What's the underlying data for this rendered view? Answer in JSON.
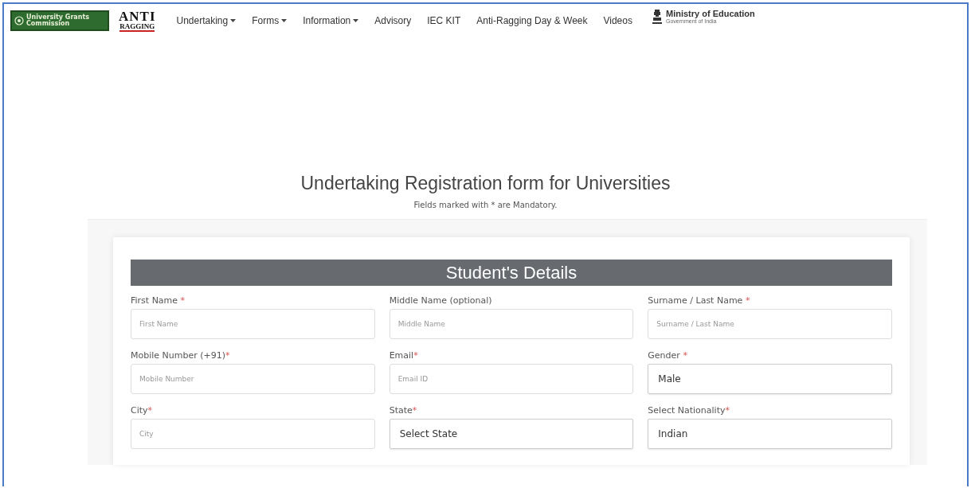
{
  "nav": {
    "ugc_logo": {
      "text": "University Grants Commission"
    },
    "anti_logo": {
      "top": "ANTI",
      "bottom": "RAGGING"
    },
    "items": [
      {
        "label": "Undertaking",
        "dropdown": true
      },
      {
        "label": "Forms",
        "dropdown": true
      },
      {
        "label": "Information",
        "dropdown": true
      },
      {
        "label": "Advisory",
        "dropdown": false
      },
      {
        "label": "IEC KIT",
        "dropdown": false
      },
      {
        "label": "Anti-Ragging Day & Week",
        "dropdown": false
      },
      {
        "label": "Videos",
        "dropdown": false
      }
    ],
    "ministry": {
      "title": "Ministry of Education",
      "subtitle": "Government of India"
    }
  },
  "heading": {
    "title": "Undertaking Registration form for Universities",
    "note": "Fields marked with * are Mandatory."
  },
  "section": {
    "title": "Student's Details",
    "fields": [
      {
        "kind": "input",
        "label": "First Name",
        "required": "*",
        "spaced": true,
        "placeholder": "First Name"
      },
      {
        "kind": "input",
        "label": "Middle Name (optional)",
        "placeholder": "Middle Name"
      },
      {
        "kind": "input",
        "label": "Surname / Last Name",
        "required": "*",
        "spaced": true,
        "placeholder": "Surname / Last Name"
      },
      {
        "kind": "input",
        "label": "Mobile Number (+91)",
        "required": "*",
        "spaced": false,
        "placeholder": "Mobile Number"
      },
      {
        "kind": "input",
        "label": "Email",
        "required": "*",
        "spaced": false,
        "placeholder": "Email ID"
      },
      {
        "kind": "select",
        "label": "Gender",
        "required": "*",
        "spaced": true,
        "value": "Male"
      },
      {
        "kind": "input",
        "label": "City",
        "required": "*",
        "spaced": false,
        "placeholder": "City"
      },
      {
        "kind": "select",
        "label": "State",
        "required": "*",
        "spaced": false,
        "value": "Select State"
      },
      {
        "kind": "select",
        "label": "Select Nationality",
        "required": "*",
        "spaced": false,
        "value": "Indian"
      }
    ]
  }
}
